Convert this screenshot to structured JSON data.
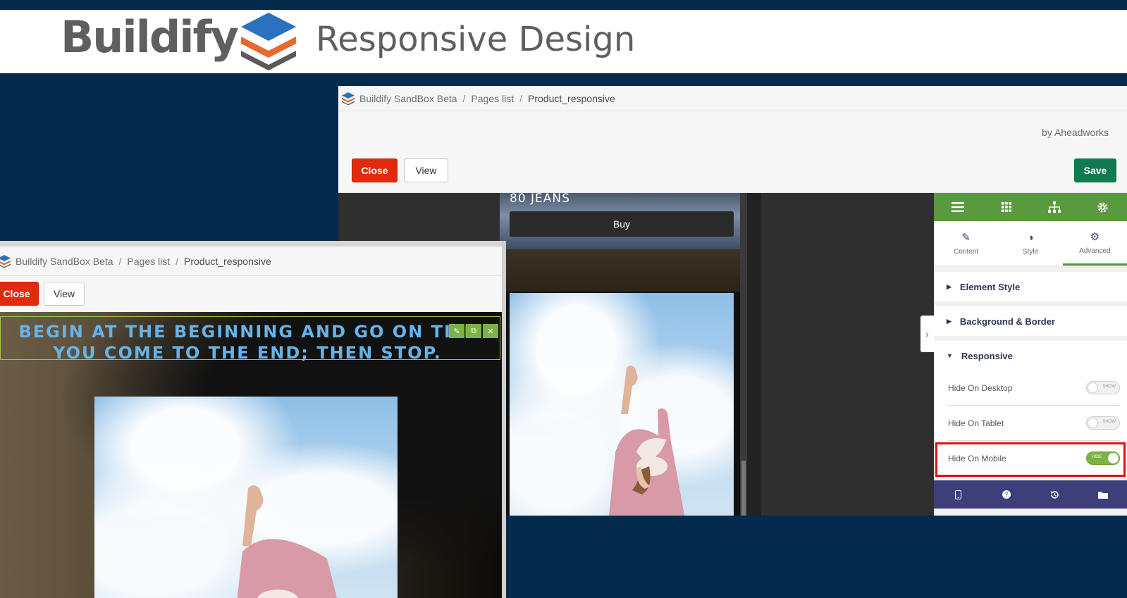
{
  "banner": {
    "brand": "Buildify",
    "subtitle": "Responsive Design",
    "colors": {
      "logo_top": "#2a72bf",
      "logo_mid": "#e8692e",
      "logo_bottom": "#5a5a5a"
    }
  },
  "right_window": {
    "breadcrumb": {
      "root": "Buildify SandBox Beta",
      "sep1": "/",
      "list": "Pages list",
      "sep2": "/",
      "current": "Product_responsive"
    },
    "byline": "by Aheadworks",
    "toolbar": {
      "close_label": "Close",
      "view_label": "View",
      "save_label": "Save"
    },
    "preview": {
      "product_text": "80 JEANS",
      "buy_label": "Buy"
    },
    "panel": {
      "top_icons": [
        "menu-icon",
        "grid-icon",
        "sitemap-icon",
        "settings-icon"
      ],
      "tabs": [
        {
          "label": "Content",
          "icon": "pencil-icon"
        },
        {
          "label": "Style",
          "icon": "contrast-icon"
        },
        {
          "label": "Advanced",
          "icon": "gear-icon",
          "active": true
        }
      ],
      "sections": [
        {
          "label": "Element Style",
          "expanded": false
        },
        {
          "label": "Background & Border",
          "expanded": false
        },
        {
          "label": "Responsive",
          "expanded": true
        }
      ],
      "responsive_rows": [
        {
          "label": "Hide On Desktop",
          "state": "SHOW",
          "on": false
        },
        {
          "label": "Hide On Tablet",
          "state": "SHOW",
          "on": false
        },
        {
          "label": "Hide On Mobile",
          "state": "HIDE",
          "on": true
        }
      ],
      "bottom_icons": [
        "mobile-icon",
        "help-icon",
        "history-icon",
        "folder-icon"
      ],
      "accent": "#5a9a3f",
      "highlight": "#e01010"
    }
  },
  "left_window": {
    "breadcrumb": {
      "root": "Buildify SandBox Beta",
      "sep1": "/",
      "list": "Pages list",
      "sep2": "/",
      "current": "Product_responsive"
    },
    "toolbar": {
      "close_label": "Close",
      "view_label": "View"
    },
    "heading": "BEGIN AT THE BEGINNING AND GO ON TILL YOU COME TO THE END; THEN STOP."
  }
}
